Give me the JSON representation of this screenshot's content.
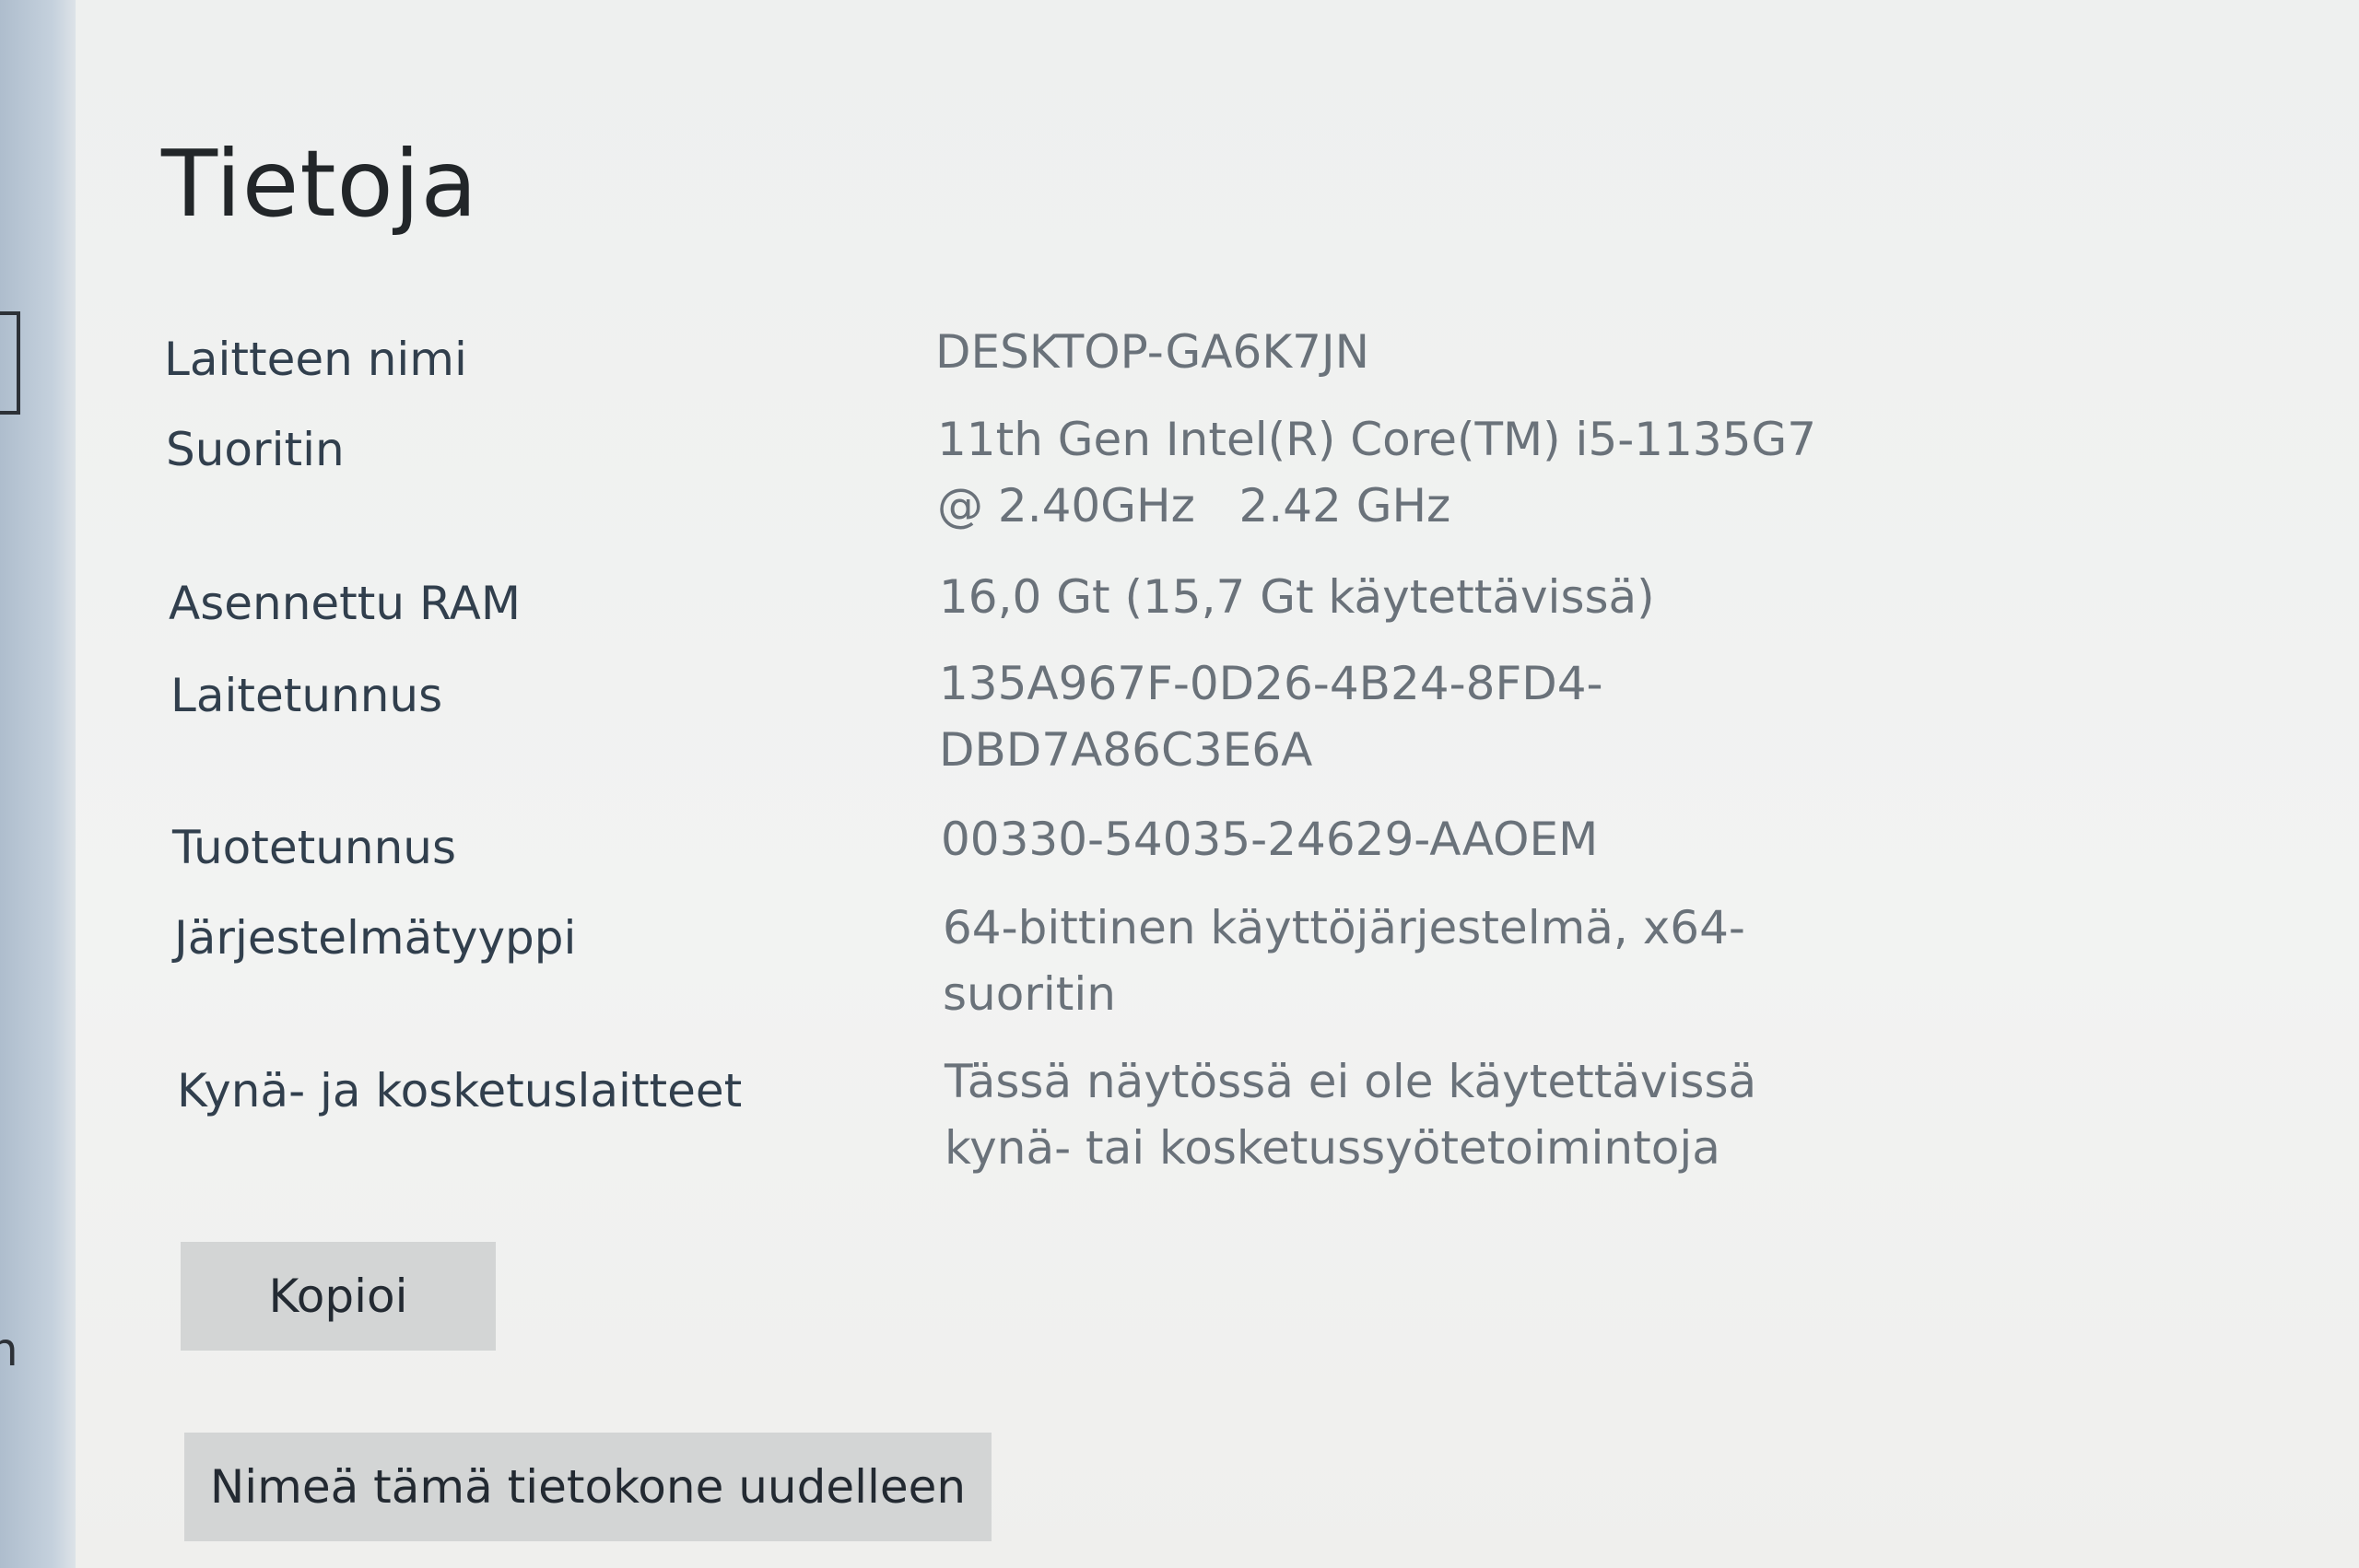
{
  "page": {
    "title": "Tietoja"
  },
  "specs": [
    {
      "label": "Laitteen nimi",
      "value": "DESKTOP-GA6K7JN"
    },
    {
      "label": "Suoritin",
      "value": "11th Gen Intel(R) Core(TM) i5-1135G7\n@ 2.40GHz   2.42 GHz"
    },
    {
      "label": "Asennettu RAM",
      "value": "16,0 Gt (15,7 Gt käytettävissä)"
    },
    {
      "label": "Laitetunnus",
      "value": "135A967F-0D26-4B24-8FD4-\nDBD7A86C3E6A"
    },
    {
      "label": "Tuotetunnus",
      "value": "00330-54035-24629-AAOEM"
    },
    {
      "label": "Järjestelmätyyppi",
      "value": "64-bittinen käyttöjärjestelmä, x64-\nsuoritin"
    },
    {
      "label": "Kynä- ja kosketuslaitteet",
      "value": "Tässä näytössä ei ole käytettävissä\nkynä- tai kosketussyötetoimintoja"
    }
  ],
  "buttons": {
    "copy_label": "Kopioi",
    "rename_label": "Nimeä tämä tietokone uudelleen"
  },
  "left_rail": {
    "partial_letter": "n"
  },
  "colors": {
    "background": "#eef0ef",
    "title_text": "#222629",
    "label_text": "#313f4d",
    "value_text": "#6a727a",
    "button_bg": "#d3d5d5"
  }
}
